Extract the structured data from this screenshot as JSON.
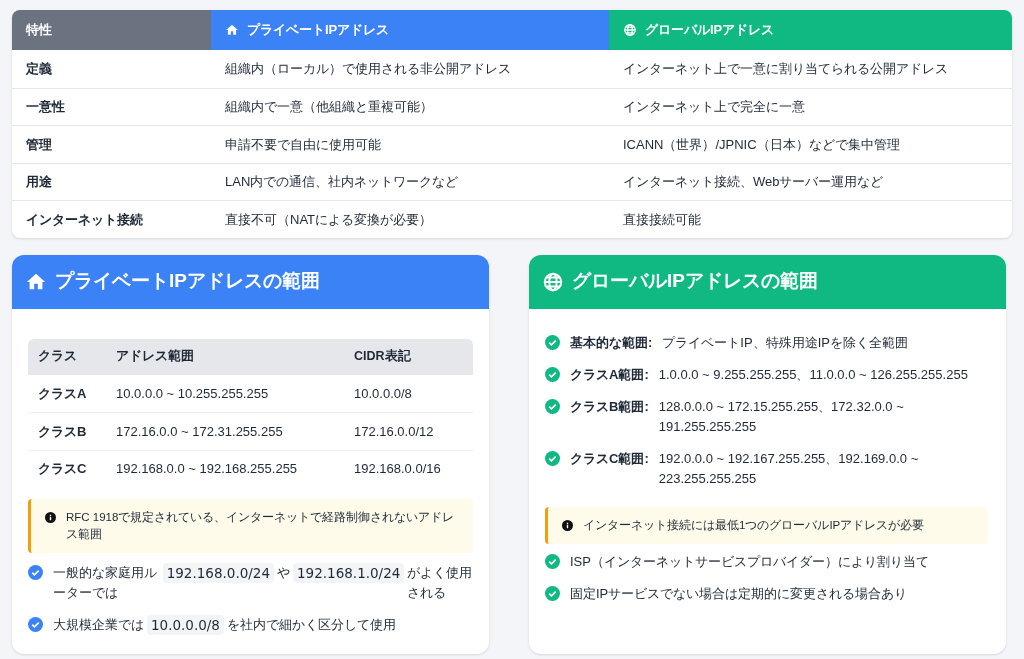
{
  "comparison_table": {
    "columns": [
      {
        "label": "特性",
        "kind": "plain"
      },
      {
        "label": "プライベートIPアドレス",
        "kind": "private"
      },
      {
        "label": "グローバルIPアドレス",
        "kind": "global"
      }
    ],
    "rows": [
      [
        "定義",
        "組織内（ローカル）で使用される非公開アドレス",
        "インターネット上で一意に割り当てられる公開アドレス"
      ],
      [
        "一意性",
        "組織内で一意（他組織と重複可能）",
        "インターネット上で完全に一意"
      ],
      [
        "管理",
        "申請不要で自由に使用可能",
        "ICANN（世界）/JPNIC（日本）などで集中管理"
      ],
      [
        "用途",
        "LAN内での通信、社内ネットワークなど",
        "インターネット接続、Webサーバー運用など"
      ],
      [
        "インターネット接続",
        "直接不可（NATによる変換が必要）",
        "直接接続可能"
      ]
    ]
  },
  "private_card": {
    "title": "プライベートIPアドレスの範囲",
    "table": {
      "columns": [
        "クラス",
        "アドレス範囲",
        "CIDR表記"
      ],
      "rows": [
        [
          "クラスA",
          "10.0.0.0 ~ 10.255.255.255",
          "10.0.0.0/8"
        ],
        [
          "クラスB",
          "172.16.0.0 ~ 172.31.255.255",
          "172.16.0.0/12"
        ],
        [
          "クラスC",
          "192.168.0.0 ~ 192.168.255.255",
          "192.168.0.0/16"
        ]
      ]
    },
    "note": "RFC 1918で規定されている、インターネットで経路制御されないアドレス範囲",
    "items": [
      [
        {
          "kind": "text",
          "text": "一般的な家庭用ルーターでは"
        },
        {
          "kind": "code",
          "text": "192.168.0.0/24"
        },
        {
          "kind": "text",
          "text": "や"
        },
        {
          "kind": "code",
          "text": "192.168.1.0/24"
        },
        {
          "kind": "text",
          "text": "がよく使用される"
        }
      ],
      [
        {
          "kind": "text",
          "text": "大規模企業では"
        },
        {
          "kind": "code",
          "text": "10.0.0.0/8"
        },
        {
          "kind": "text",
          "text": "を社内で細かく区分して使用"
        }
      ]
    ]
  },
  "global_card": {
    "title": "グローバルIPアドレスの範囲",
    "items": [
      {
        "label": "基本的な範囲:",
        "text": "プライベートIP、特殊用途IPを除く全範囲"
      },
      {
        "label": "クラスA範囲:",
        "text": "1.0.0.0 ~ 9.255.255.255、11.0.0.0 ~ 126.255.255.255"
      },
      {
        "label": "クラスB範囲:",
        "text": "128.0.0.0 ~ 172.15.255.255、172.32.0.0 ~ 191.255.255.255"
      },
      {
        "label": "クラスC範囲:",
        "text": "192.0.0.0 ~ 192.167.255.255、192.169.0.0 ~ 223.255.255.255"
      }
    ],
    "note": "インターネット接続には最低1つのグローバルIPアドレスが必要",
    "extra_items": [
      "ISP（インターネットサービスプロバイダー）により割り当て",
      "固定IPサービスでない場合は定期的に変更される場合あり"
    ]
  }
}
